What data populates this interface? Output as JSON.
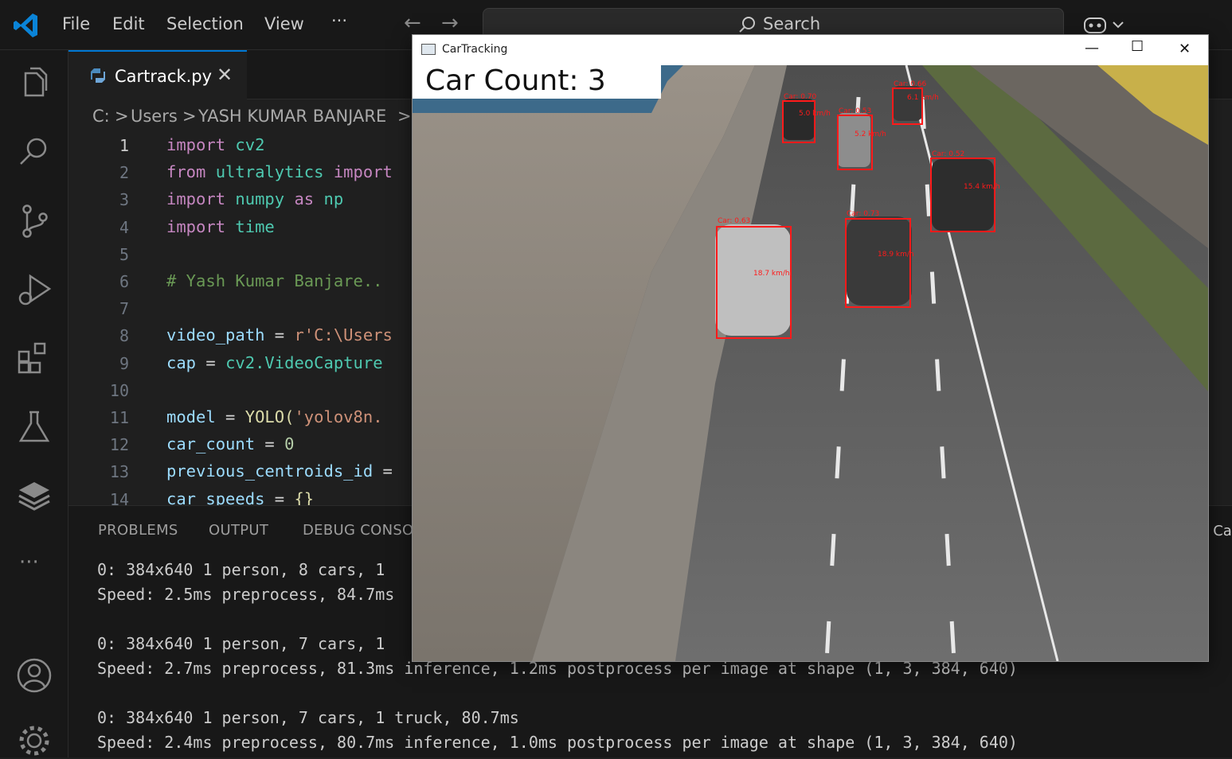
{
  "menu": {
    "file": "File",
    "edit": "Edit",
    "selection": "Selection",
    "view": "View",
    "more": "···"
  },
  "search": {
    "label": "Search"
  },
  "tab": {
    "filename": "Cartrack.py",
    "close": "✕"
  },
  "breadcrumb": [
    "C:",
    ">",
    "Users",
    ">",
    "YASH KUMAR BANJARE",
    ">"
  ],
  "code": {
    "line_numbers": [
      "1",
      "2",
      "3",
      "4",
      "5",
      "6",
      "7",
      "8",
      "9",
      "10",
      "11",
      "12",
      "13",
      "14"
    ],
    "l1a": "import",
    "l1b": "cv2",
    "l2a": "from",
    "l2b": "ultralytics",
    "l2c": "import",
    "l3a": "import",
    "l3b": "numpy",
    "l3c": "as",
    "l3d": "np",
    "l4a": "import",
    "l4b": "time",
    "l6": "# Yash Kumar Banjare..",
    "l8a": "video_path",
    "l8b": " = ",
    "l8c": "r'C:\\Users",
    "l9a": "cap",
    "l9b": " = ",
    "l9c": "cv2",
    "l9d": ".VideoCapture",
    "l11a": "model",
    "l11b": " = ",
    "l11c": "YOLO",
    "l11d": "(",
    "l11e": "'yolov8n.",
    "l12a": "car_count",
    "l12b": " = ",
    "l12c": "0",
    "l13a": "previous_centroids_id",
    "l13b": " =",
    "l14a": "car_speeds",
    "l14b": " = ",
    "l14c": "{}"
  },
  "panel": {
    "problems": "PROBLEMS",
    "output": "OUTPUT",
    "debug": "DEBUG CONSOLE",
    "cutoff": "n: Ca"
  },
  "terminal": [
    "0: 384x640 1 person, 8 cars, 1",
    "Speed: 2.5ms preprocess, 84.7ms",
    "",
    "0: 384x640 1 person, 7 cars, 1",
    "Speed: 2.7ms preprocess, 81.3ms inference, 1.2ms postprocess per image at shape (1, 3, 384, 640)",
    "",
    "0: 384x640 1 person, 7 cars, 1 truck, 80.7ms",
    "Speed: 2.4ms preprocess, 80.7ms inference, 1.0ms postprocess per image at shape (1, 3, 384, 640)"
  ],
  "window": {
    "title": "CarTracking",
    "minimize": "—",
    "maximize": "☐",
    "close": "✕",
    "count_text": "Car Count: 3"
  },
  "detections": [
    {
      "label": "Car: 0.70",
      "speed": "5.0 km/h"
    },
    {
      "label": "Car: 0.53",
      "speed": "5.2 km/h"
    },
    {
      "label": "Car: 0.66",
      "speed": "6.1 km/h"
    },
    {
      "label": "Car: 0.52",
      "speed": "15.4 km/h"
    },
    {
      "label": "Car: 0.63",
      "speed": "18.7 km/h"
    },
    {
      "label": "Car: 0.73",
      "speed": "18.9 km/h"
    }
  ],
  "icons": [
    "vscode-logo",
    "explorer-icon",
    "search-icon",
    "source-control-icon",
    "run-debug-icon",
    "extensions-icon",
    "testing-icon",
    "stack-icon",
    "more-icon",
    "account-icon",
    "settings-icon",
    "python-file-icon",
    "copilot-icon"
  ],
  "colors": {
    "accent": "#0078d4",
    "keyword": "#c586c0",
    "module": "#4ec9b0",
    "variable": "#9cdcfe",
    "string": "#ce9178",
    "comment": "#6a9955",
    "function": "#dcdcaa",
    "number": "#b5cea8",
    "detection": "#ff1a1a"
  }
}
